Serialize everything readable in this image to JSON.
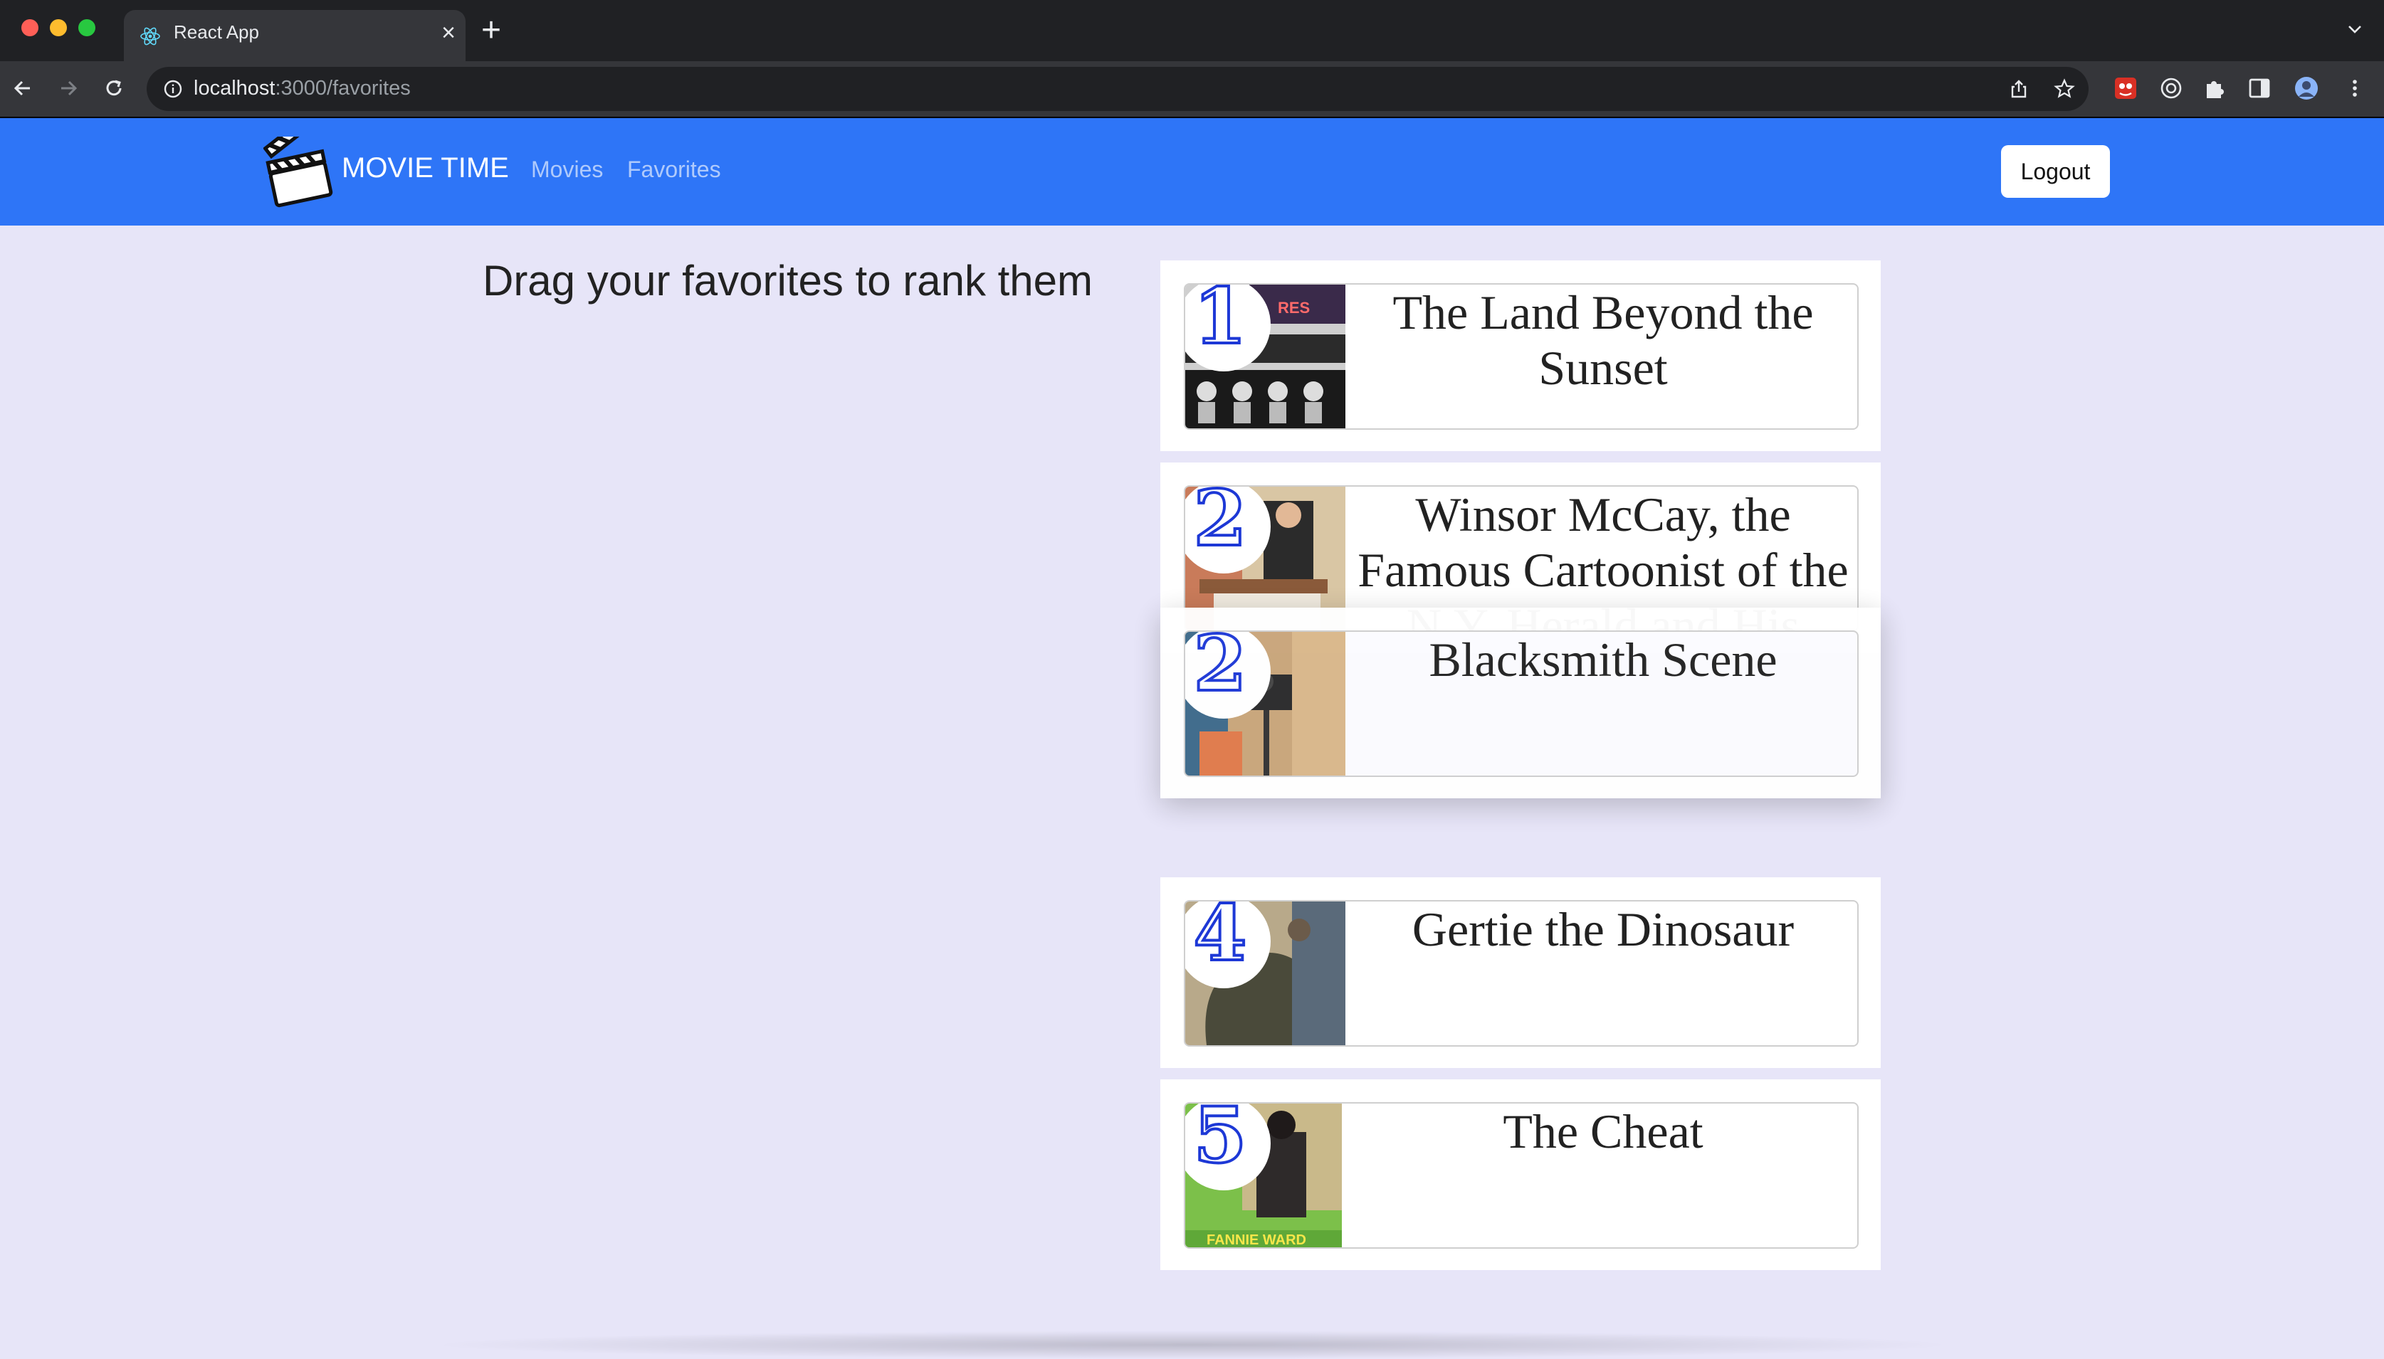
{
  "browser": {
    "tab_title": "React App",
    "url_host": "localhost",
    "url_path": ":3000/favorites"
  },
  "navbar": {
    "brand": "MOVIE TIME",
    "links": [
      "Movies",
      "Favorites"
    ],
    "logout_label": "Logout"
  },
  "page": {
    "heading": "Drag your favorites to rank them"
  },
  "favorites": [
    {
      "rank": "1",
      "title": "The Land Beyond the Sunset"
    },
    {
      "rank": "2",
      "title": "Winsor McCay, the Famous Cartoonist of the N.Y. Herald and His Moving"
    },
    {
      "rank": "2",
      "title": "Blacksmith Scene",
      "state": "dragging"
    },
    {
      "rank": "4",
      "title": "Gertie the Dinosaur"
    },
    {
      "rank": "5",
      "title": "The Cheat"
    }
  ],
  "colors": {
    "navbar": "#2e75f7",
    "page_bg": "#e7e5f8",
    "rank_outline": "#1d38d6"
  }
}
